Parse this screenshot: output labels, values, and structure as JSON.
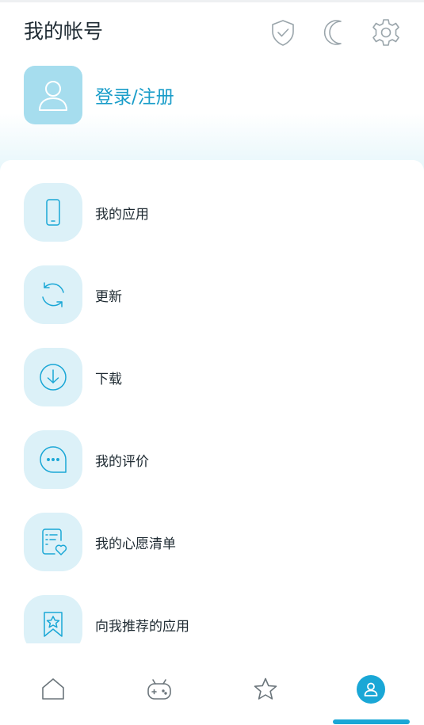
{
  "header": {
    "title": "我的帐号"
  },
  "header_icons": [
    "shield-check-icon",
    "moon-icon",
    "gear-icon"
  ],
  "profile": {
    "login_label": "登录/注册"
  },
  "menu": {
    "items": [
      {
        "label": "我的应用",
        "icon": "phone-icon"
      },
      {
        "label": "更新",
        "icon": "refresh-icon"
      },
      {
        "label": "下载",
        "icon": "download-icon"
      },
      {
        "label": "我的评价",
        "icon": "chat-bubble-icon"
      },
      {
        "label": "我的心愿清单",
        "icon": "wishlist-icon"
      },
      {
        "label": "向我推荐的应用",
        "icon": "bookmark-star-icon"
      }
    ]
  },
  "bottom_nav": {
    "items": [
      "home-icon",
      "gamepad-icon",
      "star-icon",
      "user-icon"
    ],
    "active": "user-icon"
  },
  "colors": {
    "accent": "#1aa7d6",
    "text": "#1e2a32",
    "icon_bg": "#dcf1f8",
    "avatar_bg": "#a6ddee"
  }
}
